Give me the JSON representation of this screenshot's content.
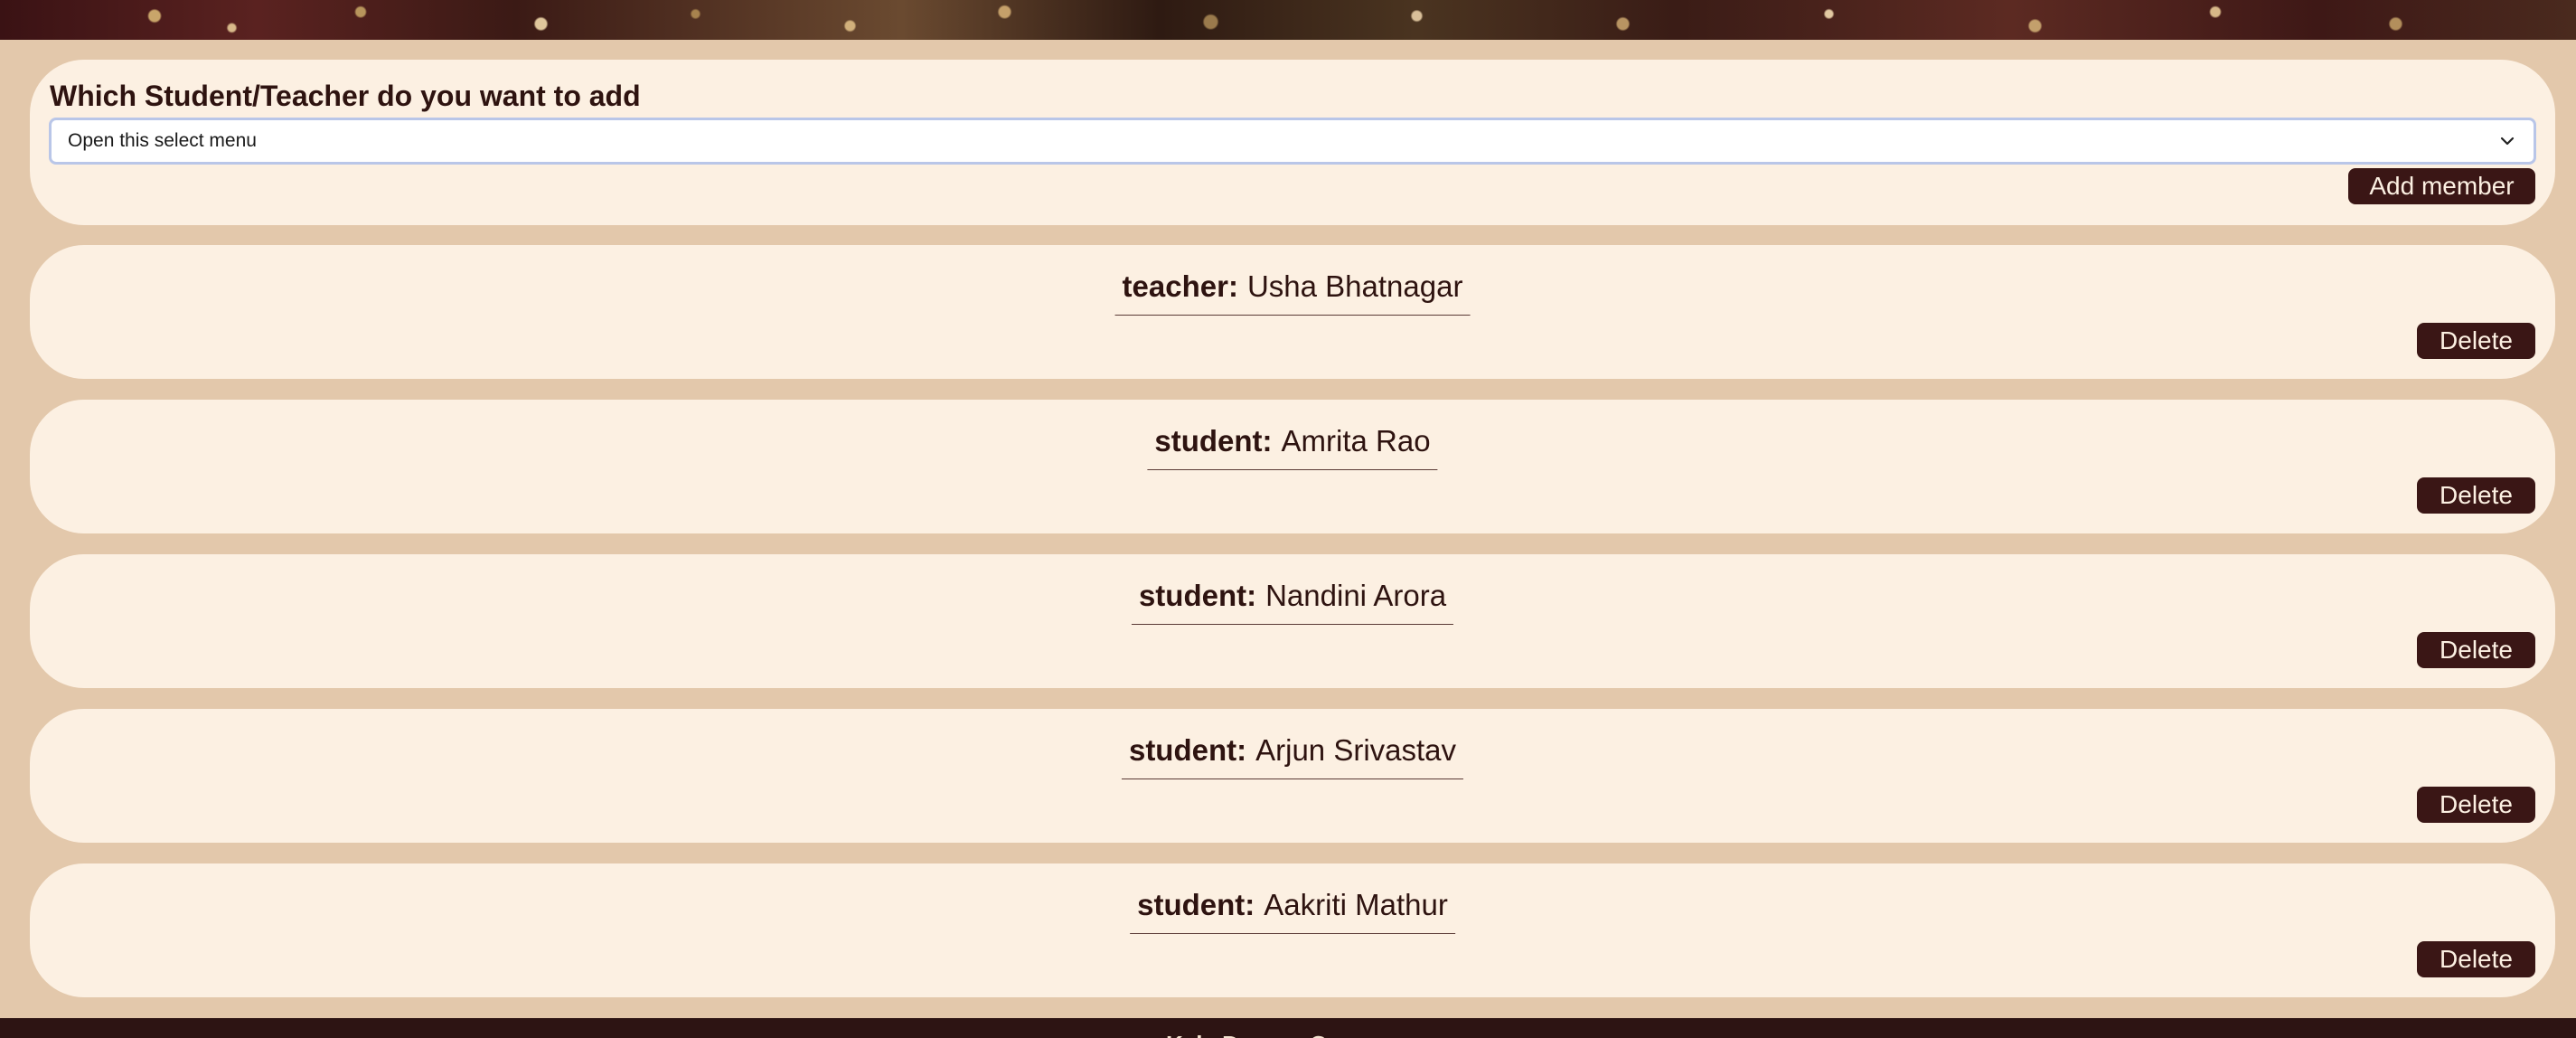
{
  "add_section": {
    "title": "Which Student/Teacher do you want to add",
    "select_value": "Open this select menu",
    "add_button_label": "Add member"
  },
  "members": [
    {
      "role": "teacher:",
      "name": "Usha Bhatnagar",
      "delete_label": "Delete"
    },
    {
      "role": "student:",
      "name": "Amrita Rao",
      "delete_label": "Delete"
    },
    {
      "role": "student:",
      "name": "Nandini Arora",
      "delete_label": "Delete"
    },
    {
      "role": "student:",
      "name": "Arjun Srivastav",
      "delete_label": "Delete"
    },
    {
      "role": "student:",
      "name": "Aakriti Mathur",
      "delete_label": "Delete"
    }
  ],
  "footer": {
    "text": "Kala Darpan Co"
  },
  "colors": {
    "page_background": "#e3c8ab",
    "panel_background": "#fcf0e2",
    "button_background": "#3a1615",
    "text": "#2e1310",
    "footer_background": "#2d1413"
  }
}
